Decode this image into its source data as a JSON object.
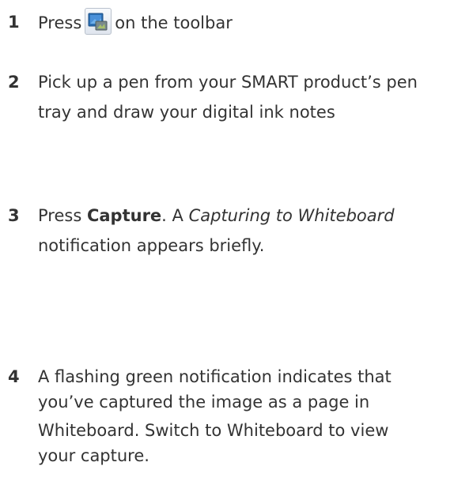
{
  "steps": [
    {
      "number": "1",
      "before_icon": "Press",
      "icon": "screen-capture-icon",
      "after_icon": "on the toolbar"
    },
    {
      "number": "2",
      "lines": [
        "Pick up a pen from your SMART product’s pen",
        "tray and draw your digital ink notes"
      ]
    },
    {
      "number": "3",
      "press_text": "Press",
      "capture_label": "Capture",
      "after_capture": ". A",
      "notification_title": "Capturing to Whiteboard",
      "line2": "notification appears briefly."
    },
    {
      "number": "4",
      "lines": [
        "A flashing green notification indicates that",
        "you’ve captured the image as a page in",
        "Whiteboard. Switch to Whiteboard to view",
        "your capture."
      ]
    }
  ],
  "colors": {
    "text": "#333333"
  }
}
